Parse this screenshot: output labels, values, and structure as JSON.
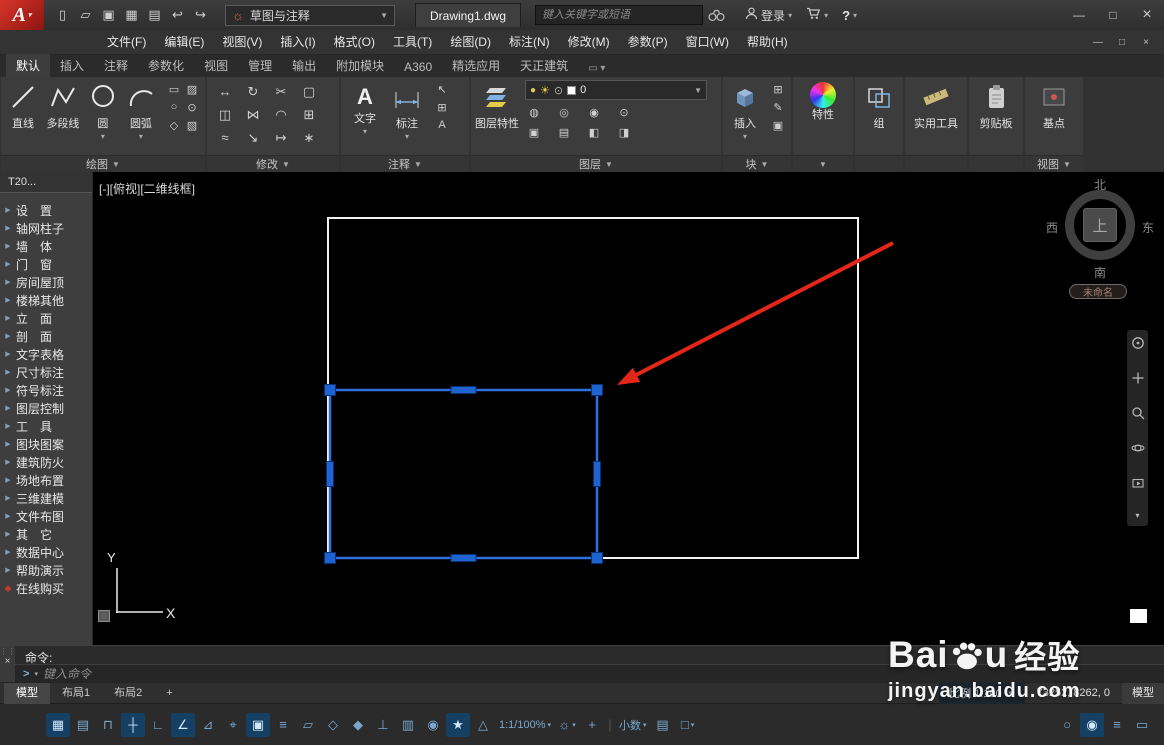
{
  "icons": {
    "caret_down": "▼",
    "caret": "▾",
    "minimize": "—",
    "maximize": "□",
    "close": "×",
    "help": "?",
    "gear": "☼",
    "dots": "⋮⋮",
    "prompt": ">",
    "ribbon_toggle": "▭",
    "text_tool": "A"
  },
  "titlebar": {
    "logo": "A",
    "quick_access": [
      {
        "name": "new-file-button",
        "glyph": "▯"
      },
      {
        "name": "open-file-button",
        "glyph": "▱"
      },
      {
        "name": "save-button",
        "glyph": "▣"
      },
      {
        "name": "save-as-button",
        "glyph": "▦"
      },
      {
        "name": "plot-button",
        "glyph": "▤"
      },
      {
        "name": "undo-button",
        "glyph": "↩"
      },
      {
        "name": "redo-button",
        "glyph": "↪"
      }
    ],
    "workspace": "草图与注释",
    "document_tab": "Drawing1.dwg",
    "search_placeholder": "键入关键字或短语",
    "signin": "登录"
  },
  "menubar": {
    "items": [
      {
        "name": "menu-file",
        "label": "文件(F)"
      },
      {
        "name": "menu-edit",
        "label": "编辑(E)"
      },
      {
        "name": "menu-view",
        "label": "视图(V)"
      },
      {
        "name": "menu-insert",
        "label": "插入(I)"
      },
      {
        "name": "menu-format",
        "label": "格式(O)"
      },
      {
        "name": "menu-tools",
        "label": "工具(T)"
      },
      {
        "name": "menu-draw",
        "label": "绘图(D)"
      },
      {
        "name": "menu-dimension",
        "label": "标注(N)"
      },
      {
        "name": "menu-modify",
        "label": "修改(M)"
      },
      {
        "name": "menu-parametric",
        "label": "参数(P)"
      },
      {
        "name": "menu-window",
        "label": "窗口(W)"
      },
      {
        "name": "menu-help",
        "label": "帮助(H)"
      }
    ]
  },
  "ribbon": {
    "tabs": [
      {
        "name": "ribbon-tab-home",
        "label": "默认",
        "cls": "on"
      },
      {
        "name": "ribbon-tab-insert",
        "label": "插入"
      },
      {
        "name": "ribbon-tab-annotate",
        "label": "注释"
      },
      {
        "name": "ribbon-tab-parametric",
        "label": "参数化"
      },
      {
        "name": "ribbon-tab-view",
        "label": "视图"
      },
      {
        "name": "ribbon-tab-manage",
        "label": "管理"
      },
      {
        "name": "ribbon-tab-output",
        "label": "输出"
      },
      {
        "name": "ribbon-tab-addins",
        "label": "附加模块"
      },
      {
        "name": "ribbon-tab-a360",
        "label": "A360"
      },
      {
        "name": "ribbon-tab-featured",
        "label": "精选应用"
      },
      {
        "name": "ribbon-tab-tianzheng",
        "label": "天正建筑"
      }
    ],
    "panels": {
      "draw": {
        "label": "绘图",
        "tools": [
          {
            "label": "直线"
          },
          {
            "label": "多段线"
          },
          {
            "label": "圆"
          },
          {
            "label": "圆弧"
          }
        ],
        "small": [
          {
            "name": "rectangle-tool",
            "glyph": "▭"
          },
          {
            "name": "hatch-tool",
            "glyph": "▨"
          },
          {
            "name": "ellipse-tool",
            "glyph": "○"
          },
          {
            "name": "point-tool",
            "glyph": "⊙"
          },
          {
            "name": "region-tool",
            "glyph": "◇"
          },
          {
            "name": "gradient-tool",
            "glyph": "▧"
          }
        ]
      },
      "modify": {
        "label": "修改",
        "tools": [
          {
            "name": "move-tool",
            "glyph": "↔"
          },
          {
            "name": "rotate-tool",
            "glyph": "↻"
          },
          {
            "name": "trim-tool",
            "glyph": "✂"
          },
          {
            "name": "erase-tool",
            "glyph": "▢"
          },
          {
            "name": "copy-tool",
            "glyph": "◫"
          },
          {
            "name": "mirror-tool",
            "glyph": "⋈"
          },
          {
            "name": "fillet-tool",
            "glyph": "◠"
          },
          {
            "name": "array-tool",
            "glyph": "⊞"
          },
          {
            "name": "offset-tool",
            "glyph": "≈"
          },
          {
            "name": "scale-tool",
            "glyph": "↘"
          },
          {
            "name": "stretch-tool",
            "glyph": "↦"
          },
          {
            "name": "explode-tool",
            "glyph": "∗"
          }
        ]
      },
      "annotate": {
        "label": "注释",
        "text_label": "文字",
        "dim_label": "标注",
        "small": [
          {
            "name": "leader-tool",
            "glyph": "↖"
          },
          {
            "name": "table-tool",
            "glyph": "⊞"
          },
          {
            "name": "text-style-tool",
            "glyph": "A"
          }
        ]
      },
      "layer": {
        "label": "图层",
        "big_label": "图层特性",
        "current_layer": "0",
        "tools": [
          {
            "name": "layer-off-tool",
            "glyph": "◍"
          },
          {
            "name": "layer-isolate-tool",
            "glyph": "◎"
          },
          {
            "name": "layer-freeze-tool",
            "glyph": "◉"
          },
          {
            "name": "layer-lock-tool",
            "glyph": "⊙"
          },
          {
            "name": "layer-match-tool",
            "glyph": "▣"
          },
          {
            "name": "layer-previous-tool",
            "glyph": "▤"
          },
          {
            "name": "layer-walk-tool",
            "glyph": "◧"
          },
          {
            "name": "layer-merge-tool",
            "glyph": "◨"
          }
        ]
      },
      "block": {
        "label": "块",
        "big_label": "插入",
        "small": [
          {
            "name": "create-block-tool",
            "glyph": "⊞"
          },
          {
            "name": "edit-block-tool",
            "glyph": "✎"
          },
          {
            "name": "block-attribute-tool",
            "glyph": "▣"
          }
        ]
      },
      "properties": {
        "label": "特性"
      },
      "group": {
        "label": "组"
      },
      "utilities": {
        "label": "实用工具"
      },
      "clipboard": {
        "label": "剪贴板"
      },
      "basepoint": {
        "label": "基点"
      },
      "view": {
        "label": "视图"
      }
    }
  },
  "sidebar": {
    "title": "T20...",
    "items": [
      {
        "name": "sidebar-item-settings",
        "label": "设　置",
        "arrow": "▶"
      },
      {
        "name": "sidebar-item-axis-grid",
        "label": "轴网柱子",
        "arrow": "▶"
      },
      {
        "name": "sidebar-item-wall",
        "label": "墙　体",
        "arrow": "▶"
      },
      {
        "name": "sidebar-item-door-window",
        "label": "门　窗",
        "arrow": "▶"
      },
      {
        "name": "sidebar-item-room-roof",
        "label": "房间屋顶",
        "arrow": "▶"
      },
      {
        "name": "sidebar-item-stairs-other",
        "label": "楼梯其他",
        "arrow": "▶"
      },
      {
        "name": "sidebar-item-elevation",
        "label": "立　面",
        "arrow": "▶"
      },
      {
        "name": "sidebar-item-section",
        "label": "剖　面",
        "arrow": "▶"
      },
      {
        "name": "sidebar-item-text-table",
        "label": "文字表格",
        "arrow": "▶"
      },
      {
        "name": "sidebar-item-dimension",
        "label": "尺寸标注",
        "arrow": "▶"
      },
      {
        "name": "sidebar-item-symbol",
        "label": "符号标注",
        "arrow": "▶"
      },
      {
        "name": "sidebar-item-layer-control",
        "label": "图层控制",
        "arrow": "▶"
      },
      {
        "name": "sidebar-item-tools",
        "label": "工　具",
        "arrow": "▶"
      },
      {
        "name": "sidebar-item-block-pattern",
        "label": "图块图案",
        "arrow": "▶"
      },
      {
        "name": "sidebar-item-fire-protection",
        "label": "建筑防火",
        "arrow": "▶"
      },
      {
        "name": "sidebar-item-site-layout",
        "label": "场地布置",
        "arrow": "▶"
      },
      {
        "name": "sidebar-item-3d-modeling",
        "label": "三维建模",
        "arrow": "▶"
      },
      {
        "name": "sidebar-item-file-layout",
        "label": "文件布图",
        "arrow": "▶"
      },
      {
        "name": "sidebar-item-other",
        "label": "其　它",
        "arrow": "▶"
      },
      {
        "name": "sidebar-item-data-center",
        "label": "数据中心",
        "arrow": "▶"
      },
      {
        "name": "sidebar-item-help-demo",
        "label": "帮助演示",
        "arrow": "▶"
      },
      {
        "name": "sidebar-item-online-purchase",
        "label": "在线购买",
        "arrow": "◆",
        "cls": "buy"
      }
    ]
  },
  "canvas": {
    "viewport_label": "[-][俯视][二维线框]",
    "viewcube": {
      "north": "北",
      "south": "南",
      "west": "西",
      "east": "东",
      "top": "上"
    },
    "view_name": "未命名",
    "ucs": {
      "x_label": "X",
      "y_label": "Y"
    }
  },
  "command": {
    "prompt": "命令:",
    "input_placeholder": "键入命令"
  },
  "layout_bar": {
    "tabs": [
      {
        "name": "model-tab",
        "label": "模型",
        "cls": "on"
      },
      {
        "name": "layout1-tab",
        "label": "布局1"
      },
      {
        "name": "layout2-tab",
        "label": "布局2"
      },
      {
        "name": "new-layout-tab",
        "label": "+"
      }
    ],
    "scale_label": "比例 1:100",
    "coordinates": "73252, 8262, 0",
    "space_toggle": "模型"
  },
  "statusbar": {
    "items": [
      {
        "name": "grid-display",
        "glyph": "▦",
        "cls": "on"
      },
      {
        "name": "snap-mode",
        "glyph": "▤"
      },
      {
        "name": "infer-constraints",
        "glyph": "⊓"
      },
      {
        "name": "dynamic-input",
        "glyph": "┼",
        "cls": "on"
      },
      {
        "name": "ortho-mode",
        "glyph": "∟"
      },
      {
        "name": "polar-tracking",
        "glyph": "∠",
        "cls": "on"
      },
      {
        "name": "isometric-drafting",
        "glyph": "⊿"
      },
      {
        "name": "object-snap-tracking",
        "glyph": "⌖"
      },
      {
        "name": "object-snap",
        "glyph": "▣",
        "cls": "on"
      },
      {
        "name": "lineweight",
        "glyph": "≡"
      },
      {
        "name": "transparency",
        "glyph": "▱"
      },
      {
        "name": "selection-cycling",
        "glyph": "◇"
      },
      {
        "name": "object-snap-3d",
        "glyph": "◆"
      },
      {
        "name": "dynamic-ucs",
        "glyph": "⊥"
      },
      {
        "name": "selection-filtering",
        "glyph": "▥"
      },
      {
        "name": "gizmo",
        "glyph": "◉"
      },
      {
        "name": "annotation-visibility",
        "glyph": "★",
        "cls": "on"
      },
      {
        "name": "autoscale",
        "glyph": "△"
      },
      {
        "name": "annotation-scale",
        "label": "1:1/100%",
        "caret": "▾"
      },
      {
        "name": "workspace-switching",
        "glyph": "☼",
        "caret": "▾"
      },
      {
        "name": "annotation-monitor",
        "glyph": "+"
      },
      {
        "name": "separator",
        "glyph": "|",
        "cls": "sep"
      },
      {
        "name": "units",
        "label": "小数",
        "caret": "▾"
      },
      {
        "name": "quick-properties",
        "glyph": "▤"
      },
      {
        "name": "lock-ui",
        "glyph": "□",
        "caret": "▾"
      },
      {
        "name": "isolate-objects",
        "glyph": "○",
        "cls": "push"
      },
      {
        "name": "graphics-performance",
        "glyph": "◉",
        "cls": "on"
      },
      {
        "name": "customization",
        "glyph": "≡"
      },
      {
        "name": "clean-screen",
        "glyph": "▭"
      }
    ]
  },
  "watermark": {
    "brand_left": "Bai",
    "brand_right": "u",
    "brand_cn": "经验",
    "url": "jingyan.baidu.com"
  }
}
